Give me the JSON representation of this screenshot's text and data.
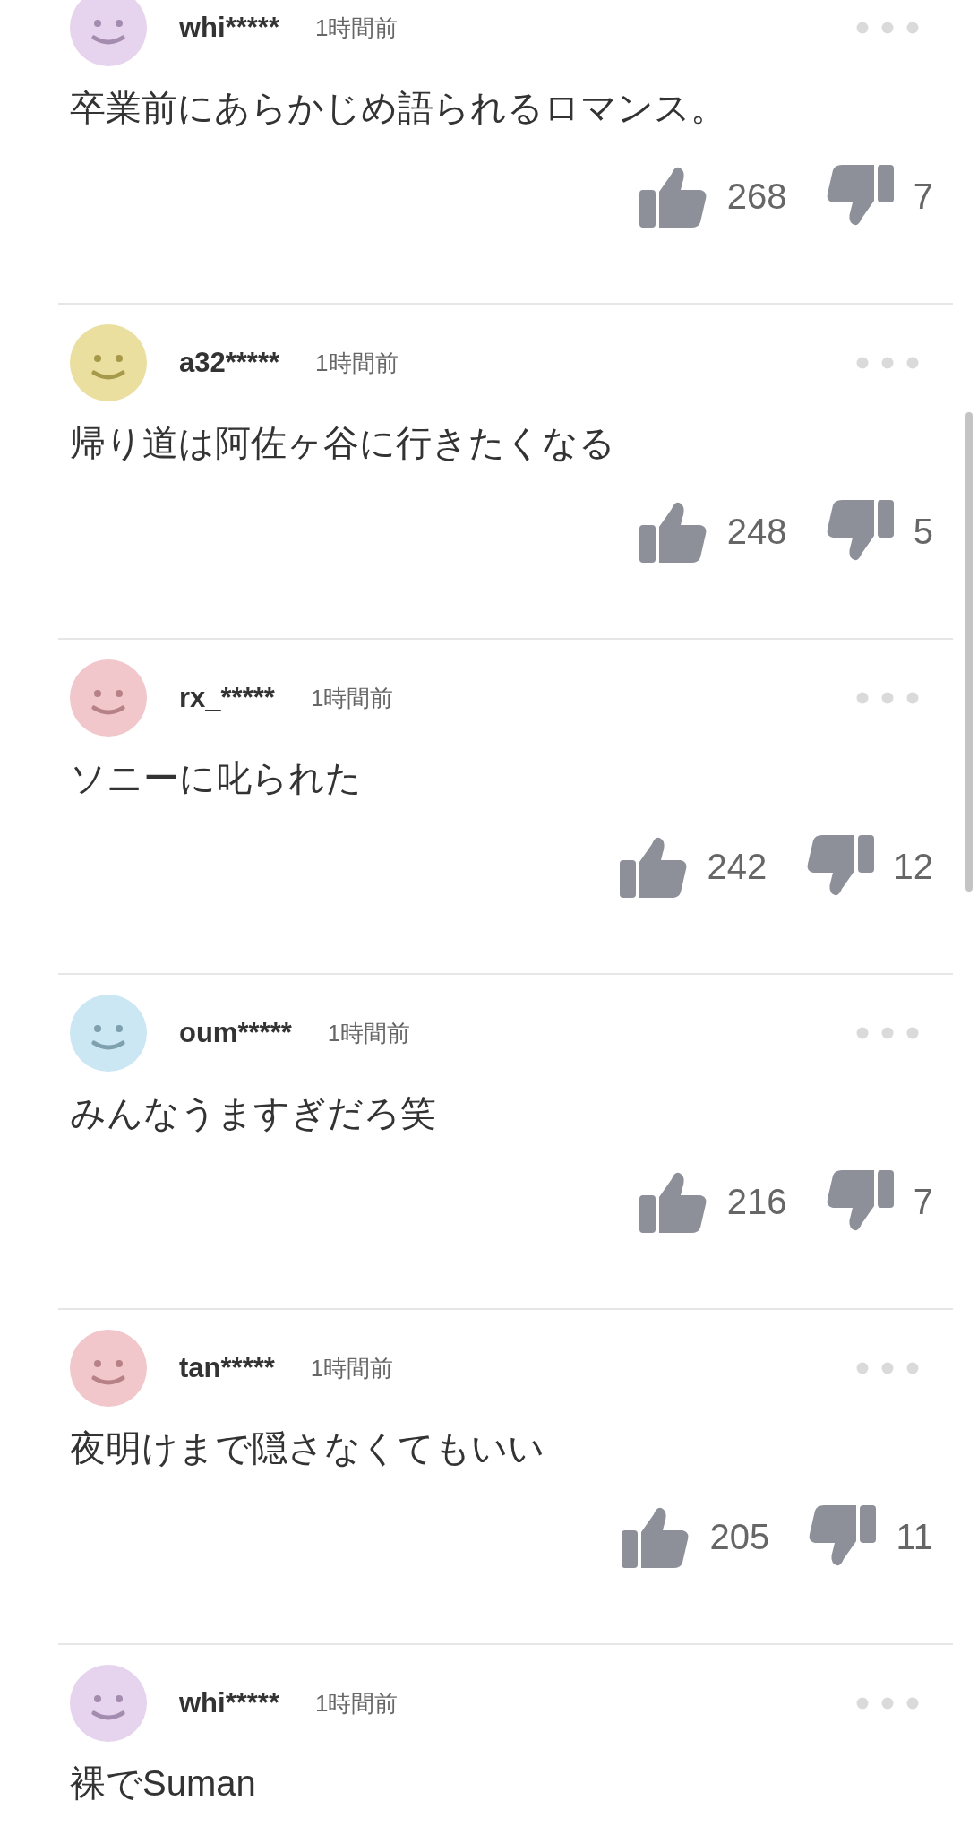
{
  "comments": [
    {
      "avatar": {
        "color": "#e6d3ee"
      },
      "user": "whi*****",
      "time": "1時間前",
      "text": "卒業前にあらかじめ語られるロマンス。",
      "likes": "268",
      "dislikes": "7"
    },
    {
      "avatar": {
        "color": "#ebdf9f"
      },
      "user": "a32*****",
      "time": "1時間前",
      "text": "帰り道は阿佐ヶ谷に行きたくなる",
      "likes": "248",
      "dislikes": "5"
    },
    {
      "avatar": {
        "color": "#f1c7cb"
      },
      "user": "rx_*****",
      "time": "1時間前",
      "text": "ソニーに叱られた",
      "likes": "242",
      "dislikes": "12"
    },
    {
      "avatar": {
        "color": "#cbe7f3"
      },
      "user": "oum*****",
      "time": "1時間前",
      "text": "みんなうますぎだろ笑",
      "likes": "216",
      "dislikes": "7"
    },
    {
      "avatar": {
        "color": "#f1c7cb"
      },
      "user": "tan*****",
      "time": "1時間前",
      "text": "夜明けまで隠さなくてもいい",
      "likes": "205",
      "dislikes": "11"
    },
    {
      "avatar": {
        "color": "#e6d3ee"
      },
      "user": "whi*****",
      "time": "1時間前",
      "text": "裸でSuman"
    }
  ]
}
